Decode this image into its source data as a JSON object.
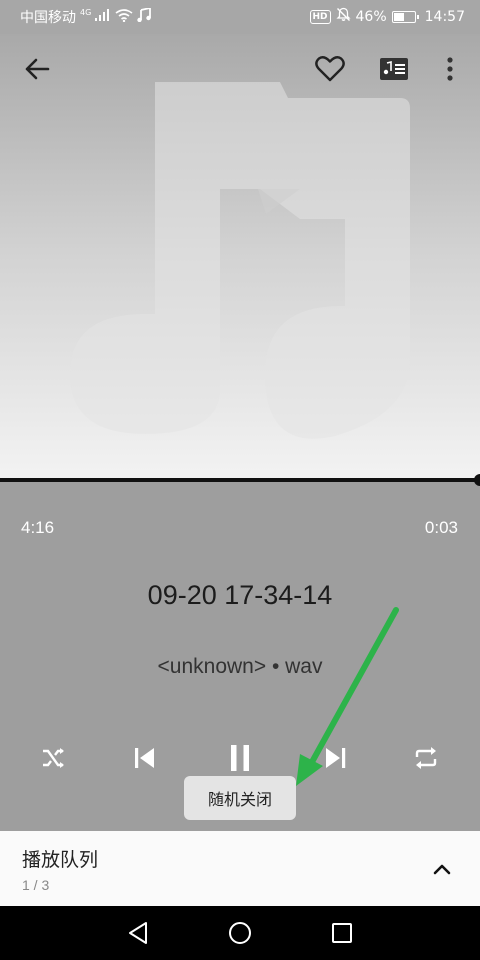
{
  "status_bar": {
    "carrier": "中国移动",
    "network": "4G",
    "battery_percent": "46%",
    "battery_level": 0.46,
    "time": "14:57",
    "hd_label": "HD",
    "icons": [
      "signal-icon",
      "wifi-icon",
      "music-note-icon",
      "mute-bell-icon",
      "battery-icon"
    ]
  },
  "toolbar": {
    "icons": [
      "back-arrow-icon",
      "heart-icon",
      "lyrics-icon",
      "more-vert-icon"
    ]
  },
  "player": {
    "progress_fraction": 1.0,
    "elapsed_time": "4:16",
    "remaining_time": "0:03",
    "track_title": "09-20 17-34-14",
    "track_subtitle": "<unknown> • wav"
  },
  "controls": {
    "icons": [
      "shuffle-icon",
      "previous-icon",
      "pause-icon",
      "next-icon",
      "repeat-icon"
    ]
  },
  "toast": {
    "message": "随机关闭"
  },
  "annotation": {
    "arrow_color": "#2db34a"
  },
  "queue": {
    "title": "播放队列",
    "count": "1 / 3",
    "expand_icon": "chevron-up-icon"
  },
  "nav_bar": {
    "icons": [
      "nav-back-icon",
      "nav-home-icon",
      "nav-recents-icon"
    ]
  },
  "colors": {
    "background": "#9e9e9e",
    "toast_bg": "#e4e4e4",
    "queue_bg": "#fafafa",
    "nav_bg": "#000000"
  }
}
